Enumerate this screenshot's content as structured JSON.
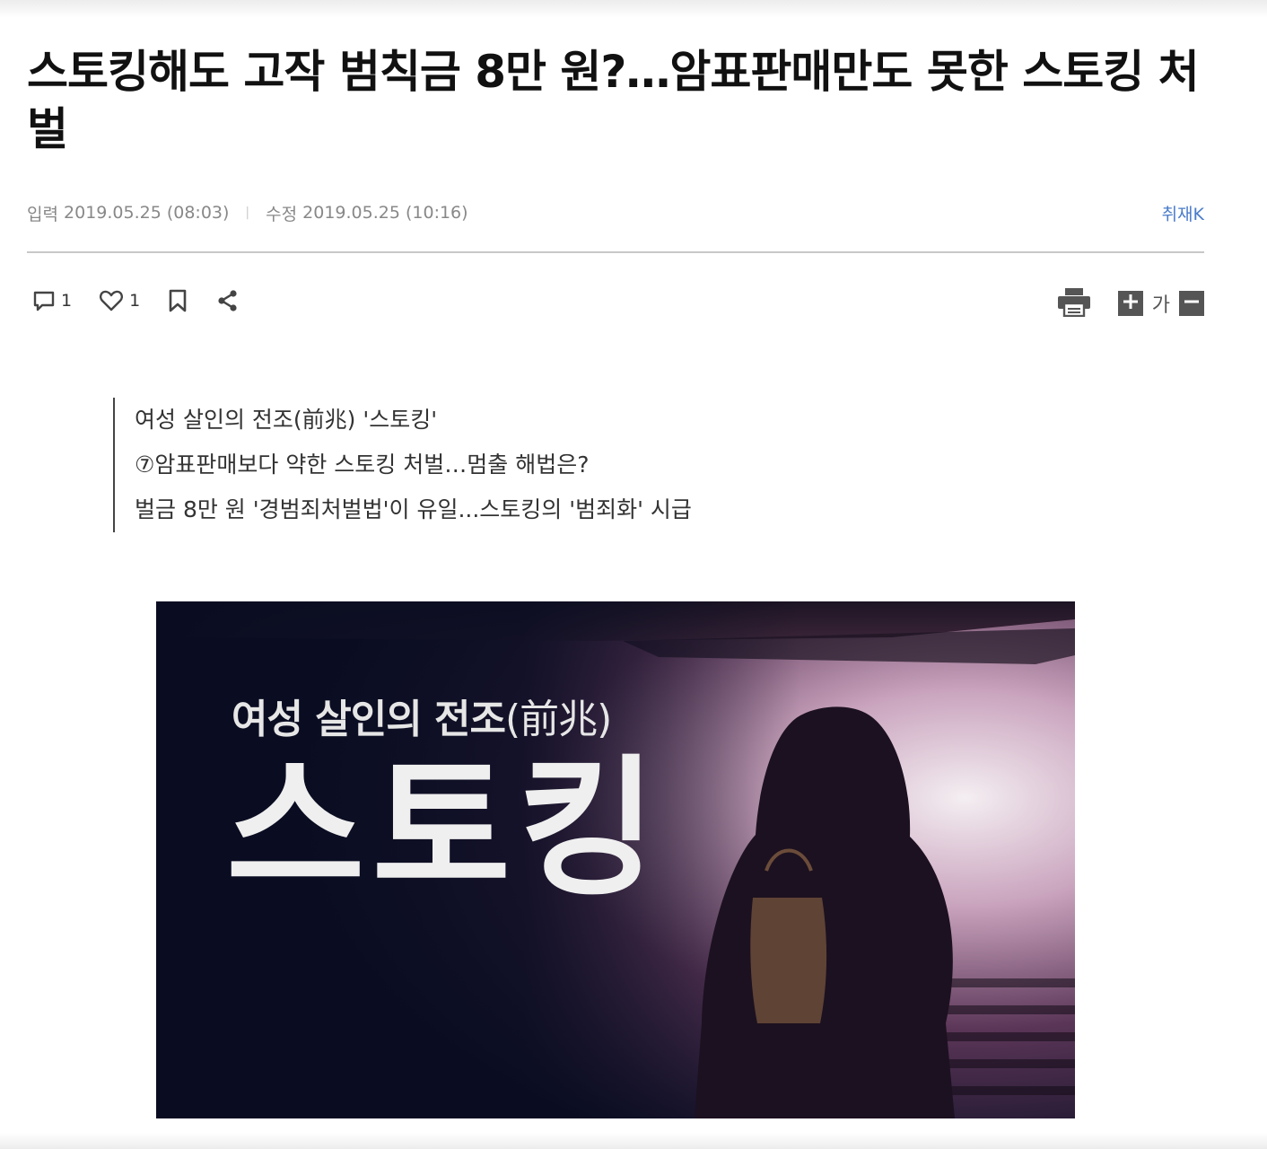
{
  "article": {
    "headline": "스토킹해도 고작 범칙금 8만 원?…암표판매만도 못한 스토킹 처벌",
    "input_label": "입력",
    "input_date": "2019.05.25 (08:03)",
    "separator": "|",
    "modified_label": "수정",
    "modified_date": "2019.05.25 (10:16)",
    "reporter": "취재K"
  },
  "toolbar": {
    "comment_count": "1",
    "like_count": "1",
    "font_size_label": "가",
    "icons": [
      "comment-icon",
      "heart-icon",
      "bookmark-icon",
      "share-icon",
      "print-icon",
      "plus-icon",
      "minus-icon"
    ]
  },
  "summary": {
    "lines": [
      "여성 살인의 전조(前兆) '스토킹'",
      "⑦암표판매보다 약한 스토킹 처벌…멈출 해법은?",
      "벌금 8만 원 '경범죄처벌법'이 유일...스토킹의 '범죄화' 시급"
    ]
  },
  "hero_image": {
    "subtitle_bold": "여성 살인의 전조",
    "subtitle_light": "(前兆)",
    "title": "스토킹"
  },
  "colors": {
    "reporter_link": "#4a7cc9",
    "hero_background": "#0a0d22",
    "hero_glow": "#c9a3bd"
  }
}
